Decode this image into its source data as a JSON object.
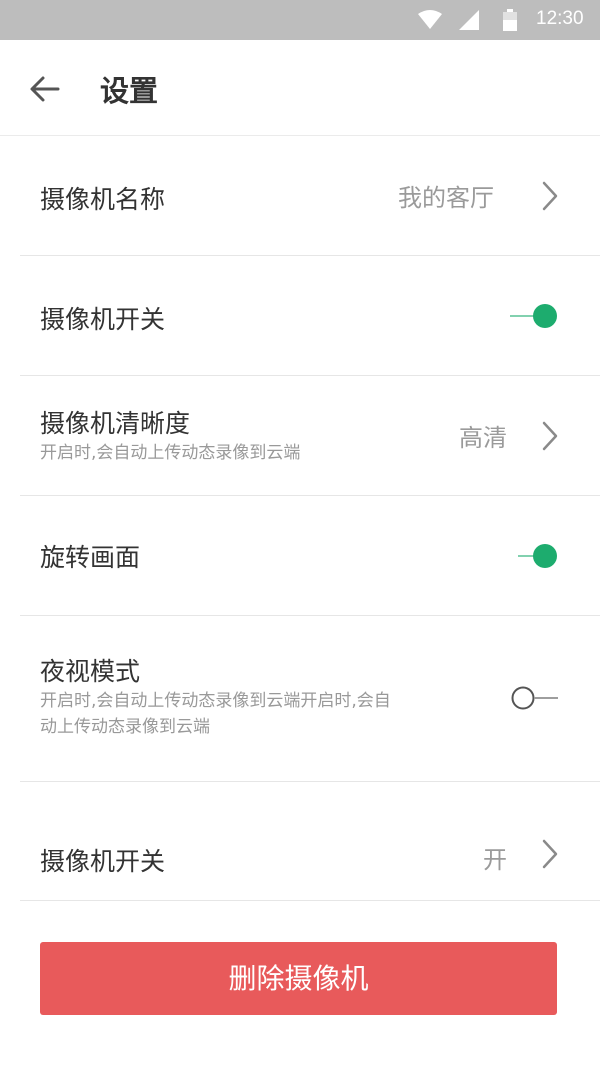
{
  "status_bar": {
    "time": "12:30"
  },
  "header": {
    "title": "设置"
  },
  "settings": [
    {
      "label": "摄像机名称",
      "value": "我的客厅",
      "control": "chevron-right-icon"
    },
    {
      "label": "摄像机开关",
      "toggle_on": true
    },
    {
      "label": "摄像机清晰度",
      "subtitle": "开启时,会自动上传动态录像到云端",
      "value": "高清",
      "control": "chevron-right-icon"
    },
    {
      "label": "旋转画面",
      "toggle_on": true
    },
    {
      "label": "夜视模式",
      "subtitle_line1": "开启时,会自动上传动态录像到云端开启时,会自",
      "subtitle_line2": "动上传动态录像到云端",
      "toggle_on": false
    },
    {
      "label": "摄像机开关",
      "value": "开",
      "control": "chevron-right-icon"
    }
  ],
  "delete_button": {
    "label": "删除摄像机"
  },
  "colors": {
    "accent": "#1dac6e",
    "danger": "#e85a5b",
    "status_bar": "#bdbdbd"
  }
}
